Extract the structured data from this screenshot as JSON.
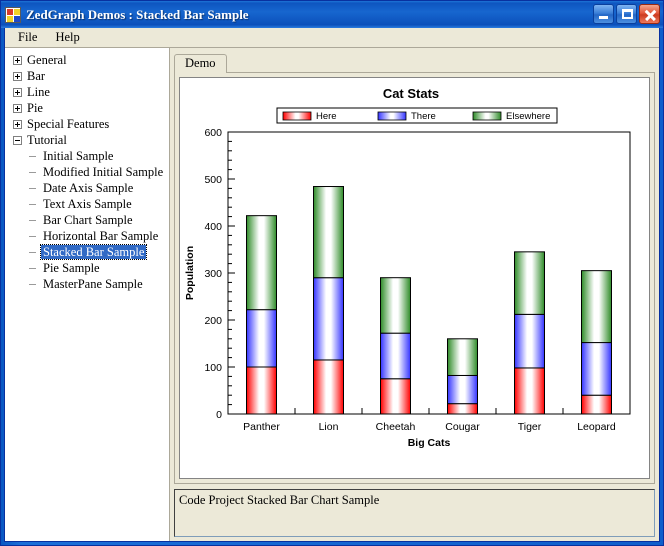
{
  "window": {
    "title": "ZedGraph Demos : Stacked Bar Sample",
    "icon": "app-icon",
    "buttons": {
      "minimize": "_",
      "maximize": "□",
      "close": "✕"
    }
  },
  "menu": {
    "items": [
      {
        "label": "File"
      },
      {
        "label": "Help"
      }
    ]
  },
  "tree": {
    "nodes": [
      {
        "label": "General",
        "level": 0,
        "expander": "plus",
        "selected": false
      },
      {
        "label": "Bar",
        "level": 0,
        "expander": "plus",
        "selected": false
      },
      {
        "label": "Line",
        "level": 0,
        "expander": "plus",
        "selected": false
      },
      {
        "label": "Pie",
        "level": 0,
        "expander": "plus",
        "selected": false
      },
      {
        "label": "Special Features",
        "level": 0,
        "expander": "plus",
        "selected": false
      },
      {
        "label": "Tutorial",
        "level": 0,
        "expander": "minus",
        "selected": false
      },
      {
        "label": "Initial Sample",
        "level": 1,
        "expander": "leaf",
        "selected": false
      },
      {
        "label": "Modified Initial Sample",
        "level": 1,
        "expander": "leaf",
        "selected": false
      },
      {
        "label": "Date Axis Sample",
        "level": 1,
        "expander": "leaf",
        "selected": false
      },
      {
        "label": "Text Axis Sample",
        "level": 1,
        "expander": "leaf",
        "selected": false
      },
      {
        "label": "Bar Chart Sample",
        "level": 1,
        "expander": "leaf",
        "selected": false
      },
      {
        "label": "Horizontal Bar Sample",
        "level": 1,
        "expander": "leaf",
        "selected": false
      },
      {
        "label": "Stacked Bar Sample",
        "level": 1,
        "expander": "leaf",
        "selected": true
      },
      {
        "label": "Pie Sample",
        "level": 1,
        "expander": "leaf",
        "selected": false
      },
      {
        "label": "MasterPane Sample",
        "level": 1,
        "expander": "leaf",
        "selected": false
      }
    ]
  },
  "tabs": [
    {
      "label": "Demo",
      "active": true
    }
  ],
  "status": {
    "text": "Code Project Stacked Bar Chart Sample"
  },
  "chart_data": {
    "type": "bar",
    "stacked": true,
    "title": "Cat Stats",
    "xlabel": "Big Cats",
    "ylabel": "Population",
    "categories": [
      "Panther",
      "Lion",
      "Cheetah",
      "Cougar",
      "Tiger",
      "Leopard"
    ],
    "ylim": [
      0,
      600
    ],
    "ytick_step": 100,
    "yticks": [
      0,
      100,
      200,
      300,
      400,
      500,
      600
    ],
    "minor_ticks_per_interval": 5,
    "grid": false,
    "legend_position": "top",
    "series": [
      {
        "name": "Here",
        "color": "#ff0000",
        "values": [
          100,
          115,
          75,
          22,
          98,
          40
        ]
      },
      {
        "name": "There",
        "color": "#3333ff",
        "values": [
          122,
          175,
          97,
          60,
          114,
          112
        ]
      },
      {
        "name": "Elsewhere",
        "color": "#2e8b28",
        "values": [
          200,
          194,
          118,
          78,
          133,
          153
        ]
      }
    ],
    "totals": [
      422,
      484,
      290,
      160,
      345,
      305
    ]
  }
}
